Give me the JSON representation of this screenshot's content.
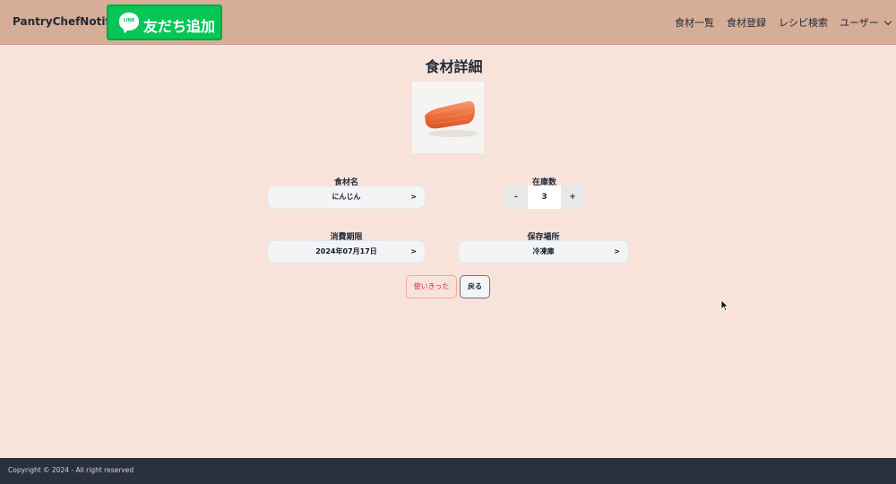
{
  "header": {
    "brand": "PantryChefNotifier",
    "line_button": {
      "logo_text": "LINE",
      "label": "友だち追加"
    },
    "nav": [
      {
        "label": "食材一覧"
      },
      {
        "label": "食材登録"
      },
      {
        "label": "レシピ検索"
      },
      {
        "label": "ユーザー"
      }
    ]
  },
  "main": {
    "title": "食材詳細",
    "photo_icon": "carrot-photo",
    "fields": {
      "name": {
        "label": "食材名",
        "value": "にんじん",
        "arrow": ">"
      },
      "quantity": {
        "label": "在庫数",
        "value": "3",
        "minus": "-",
        "plus": "+"
      },
      "expiry": {
        "label": "消費期限",
        "value": "2024年07月17日",
        "arrow": ">"
      },
      "storage": {
        "label": "保存場所",
        "value": "冷凍庫",
        "arrow": ">"
      }
    },
    "buttons": {
      "used_up": "使いきった",
      "back": "戻る"
    }
  },
  "footer": {
    "copyright": "Copyright © 2024 - All right reserved"
  },
  "colors": {
    "page_bg": "#f8e3db",
    "header_bg": "#d6ad96",
    "line_green": "#06c755",
    "footer_bg": "#2a303c",
    "danger": "#e11d48"
  }
}
